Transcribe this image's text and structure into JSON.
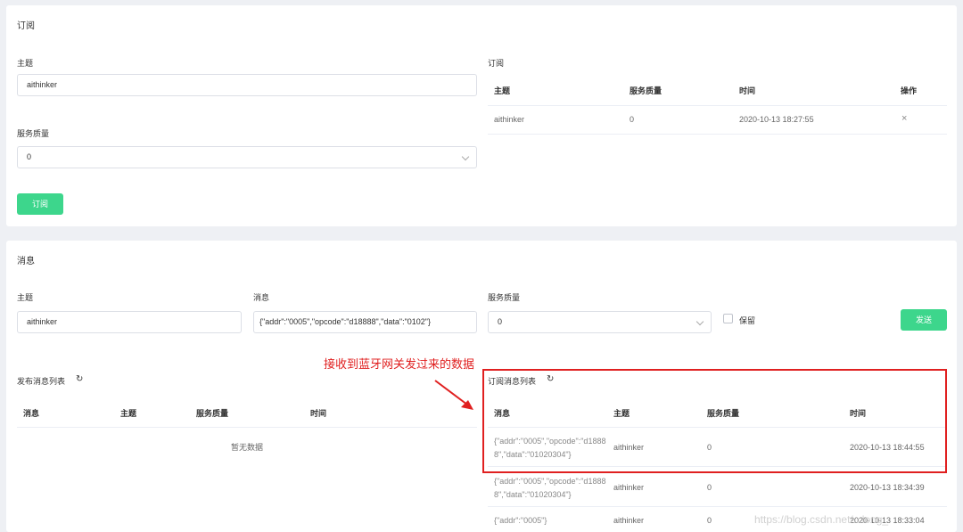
{
  "subscribe_section": {
    "title": "订阅",
    "topic_label": "主题",
    "topic_value": "aithinker",
    "qos_label": "服务质量",
    "qos_value": "0",
    "subscribe_button": "订阅",
    "subscriptions": {
      "title": "订阅",
      "headers": [
        "主题",
        "服务质量",
        "时间",
        "操作"
      ],
      "rows": [
        {
          "topic": "aithinker",
          "qos": "0",
          "time": "2020-10-13 18:27:55",
          "action": "×"
        }
      ]
    }
  },
  "message_section": {
    "title": "消息",
    "topic_label": "主题",
    "topic_value": "aithinker",
    "message_label": "消息",
    "message_value": "{\"addr\":\"0005\",\"opcode\":\"d18888\",\"data\":\"0102\"}",
    "qos_label": "服务质量",
    "qos_value": "0",
    "retain_label": "保留",
    "send_button": "发送",
    "published": {
      "title": "发布消息列表",
      "headers": [
        "消息",
        "主题",
        "服务质量",
        "时间"
      ],
      "empty_text": "暂无数据"
    },
    "received": {
      "title": "订阅消息列表",
      "headers": [
        "消息",
        "主题",
        "服务质量",
        "时间"
      ],
      "rows": [
        {
          "msg_line1": "{\"addr\":\"0005\",\"opcode\":\"d1888",
          "msg_line2": "8\",\"data\":\"01020304\"}",
          "topic": "aithinker",
          "qos": "0",
          "time": "2020-10-13 18:44:55"
        },
        {
          "msg_line1": "{\"addr\":\"0005\",\"opcode\":\"d1888",
          "msg_line2": "8\",\"data\":\"01020304\"}",
          "topic": "aithinker",
          "qos": "0",
          "time": "2020-10-13 18:34:39"
        },
        {
          "msg_line1": "{\"addr\":\"0005\"}",
          "msg_line2": "",
          "topic": "aithinker",
          "qos": "0",
          "time": "2020-10-13 18:33:04"
        }
      ]
    }
  },
  "annotation": {
    "text": "接收到蓝牙网关发过来的数据",
    "color": "#e02020"
  },
  "watermark": "https://blog.csdn.net/...long_",
  "colors": {
    "accent_green": "#3dd68c",
    "background": "#eef0f4",
    "annotation_red": "#e02020"
  },
  "icons": {
    "refresh": "refresh-icon",
    "close": "close-icon",
    "dropdown": "chevron-down-icon",
    "arrow": "annotation-arrow"
  }
}
